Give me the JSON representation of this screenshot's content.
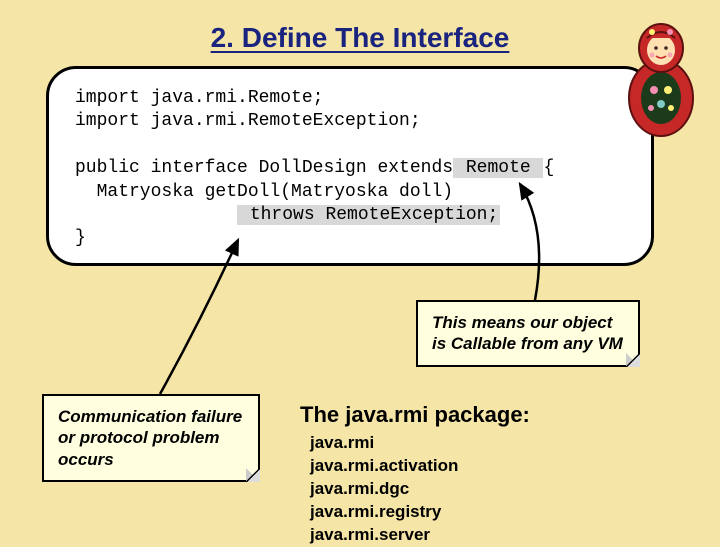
{
  "title": "2. Define The Interface",
  "code": {
    "line1": "import java.rmi.Remote;",
    "line2": "import java.rmi.RemoteException;",
    "line3a": "public interface DollDesign extends",
    "line3b_hl": " Remote ",
    "line3c": "{",
    "line4": "  Matryoska getDoll(Matryoska doll)",
    "line5a": "               ",
    "line5b_hl": " throws RemoteException;",
    "line6": "}"
  },
  "note_right": "This means our object is Callable from any VM",
  "note_left": "Communication failure or protocol problem occurs",
  "pkg": {
    "heading": "The java.rmi package:",
    "items": [
      "java.rmi",
      "java.rmi.activation",
      "java.rmi.dgc",
      "java.rmi.registry",
      "java.rmi.server"
    ]
  }
}
